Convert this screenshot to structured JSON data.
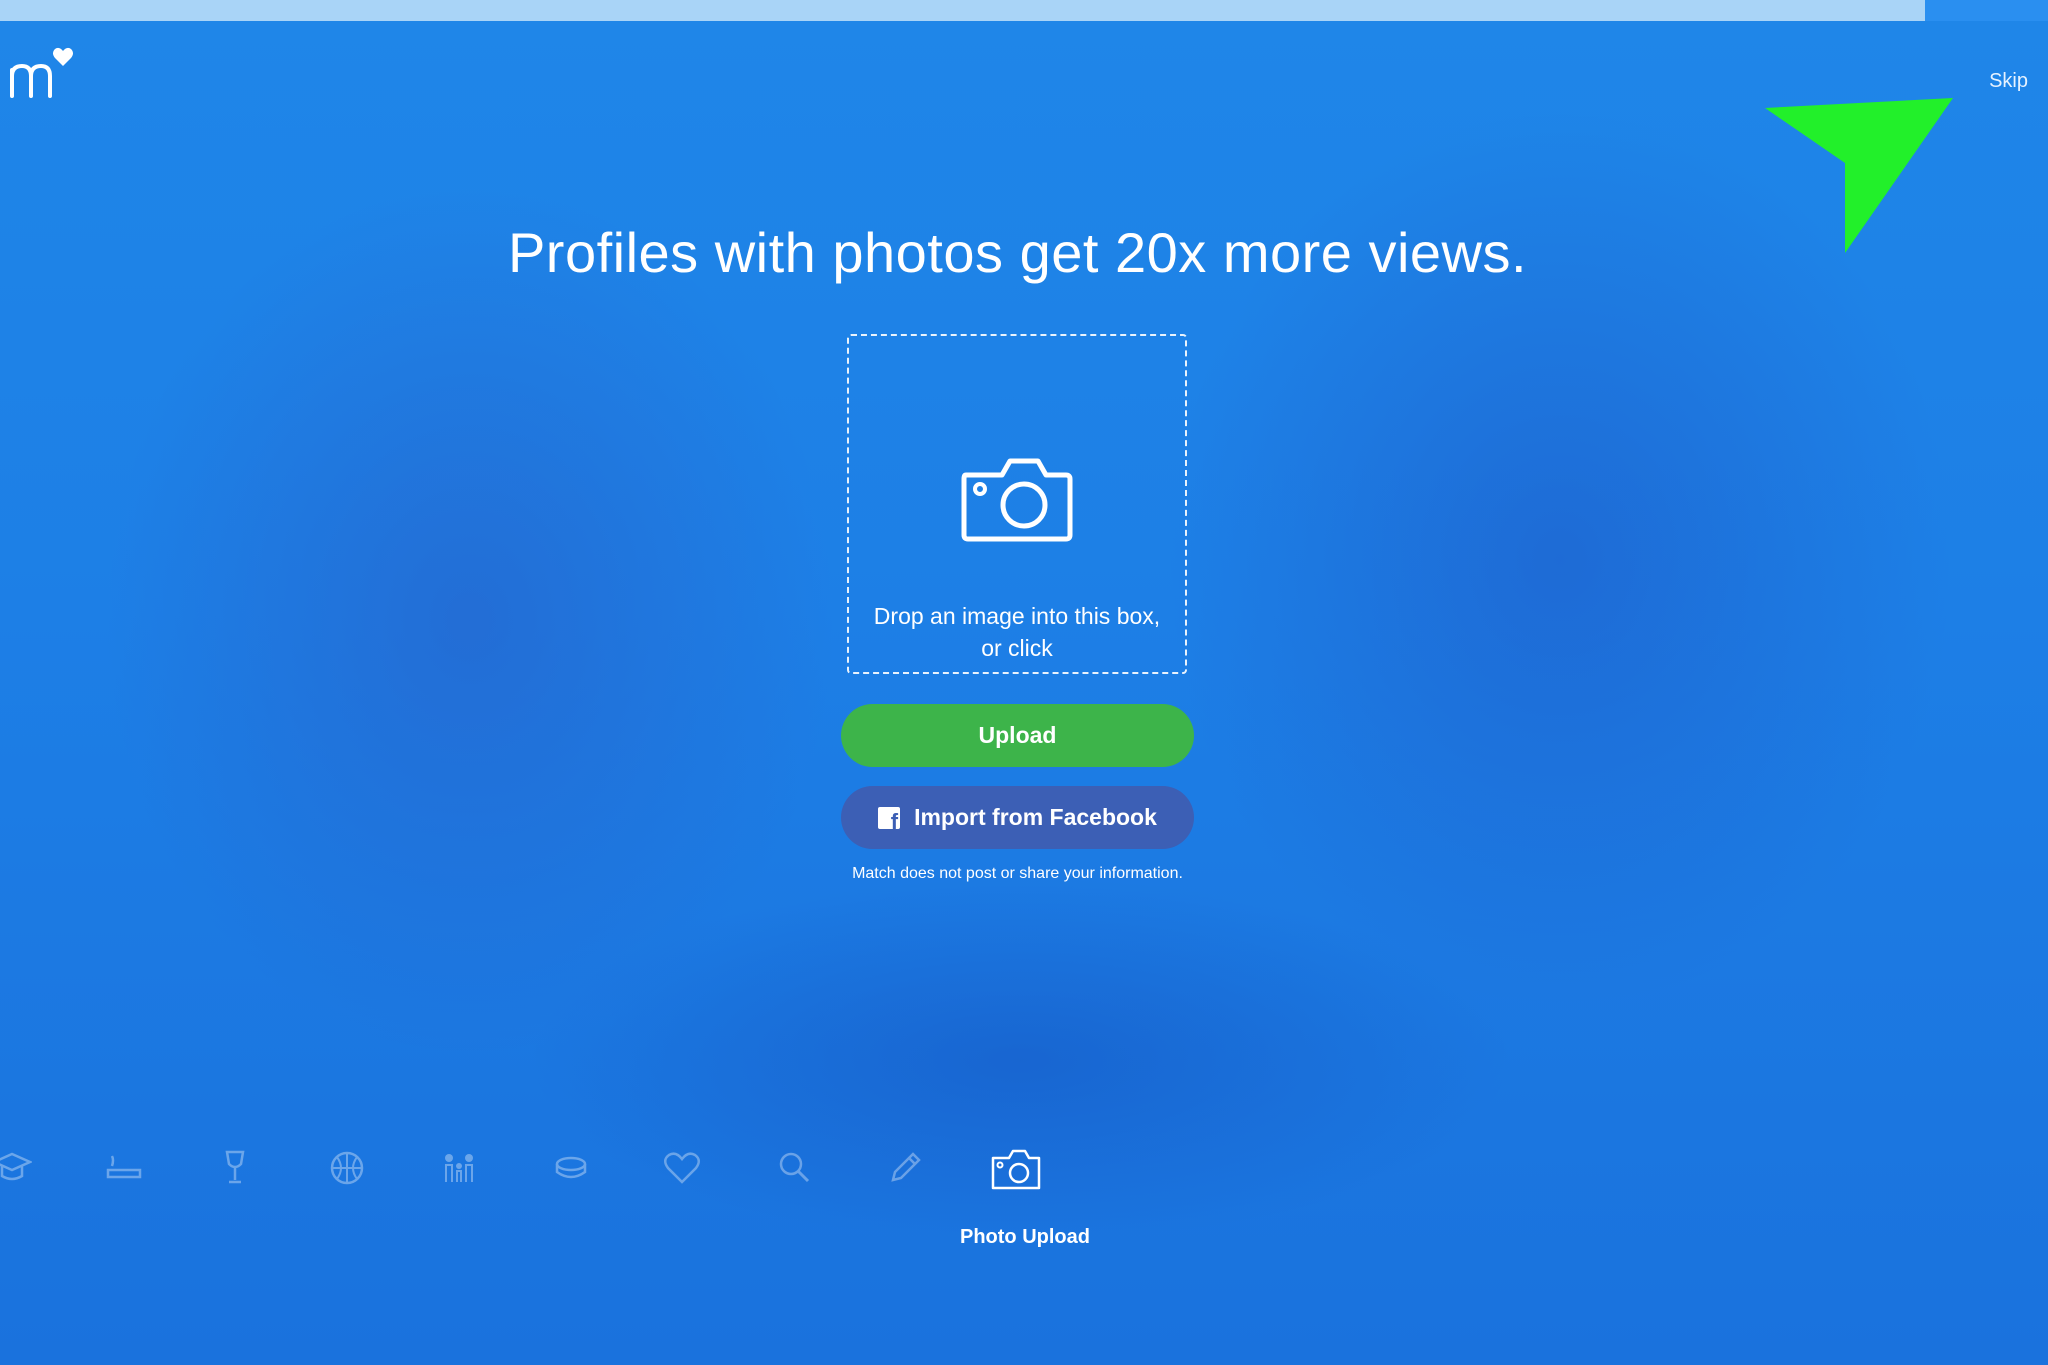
{
  "progress": {
    "fraction": 0.94
  },
  "brand": {
    "logo_icon": "match-logo-icon",
    "logo_letter": "m"
  },
  "header": {
    "skip_label": "Skip"
  },
  "main": {
    "headline": "Profiles with photos get 20x more views.",
    "dropzone_text": "Drop an image into this box, or click",
    "upload_label": "Upload",
    "facebook_label": "Import from Facebook",
    "disclaimer": "Match does not post or share your information."
  },
  "steps": {
    "icons": [
      "graduation-cap-icon",
      "cigarette-icon",
      "wine-glass-icon",
      "basketball-icon",
      "family-icon",
      "money-icon",
      "heart-icon",
      "search-icon",
      "pencil-icon",
      "camera-icon"
    ],
    "active_label": "Photo Upload"
  },
  "colors": {
    "background": "#1f86e8",
    "upload_button": "#3db44a",
    "facebook_button": "#3c5fb5",
    "pointer_arrow": "#22f02a"
  }
}
